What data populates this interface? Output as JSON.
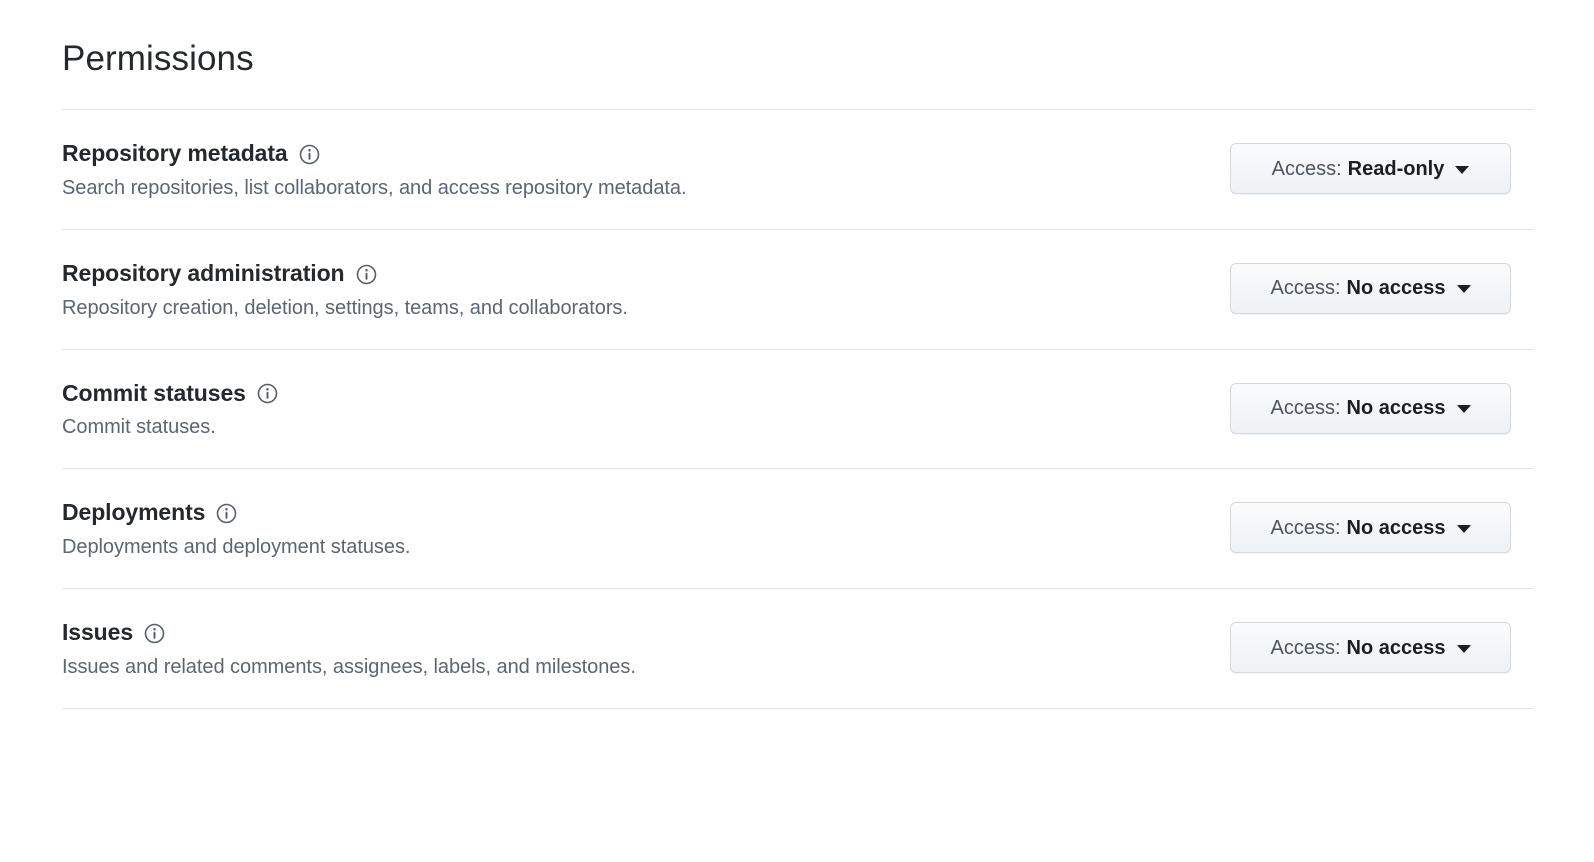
{
  "page": {
    "title": "Permissions"
  },
  "icons": {
    "info": "info-icon",
    "caret": "chevron-down-icon"
  },
  "colors": {
    "text_primary": "#24292e",
    "text_secondary": "#5a6672",
    "divider": "#e1e4e8",
    "button_border": "#d5d9dd",
    "button_bg_top": "#fafbfc",
    "button_bg_bottom": "#eff3f6",
    "button_label_prefix": "#4c555f",
    "button_label_value": "#1b1f23"
  },
  "access_label_prefix": "Access:",
  "permissions": [
    {
      "name": "Repository metadata",
      "description": "Search repositories, list collaborators, and access repository metadata.",
      "access": "Read-only"
    },
    {
      "name": "Repository administration",
      "description": "Repository creation, deletion, settings, teams, and collaborators.",
      "access": "No access"
    },
    {
      "name": "Commit statuses",
      "description": "Commit statuses.",
      "access": "No access"
    },
    {
      "name": "Deployments",
      "description": "Deployments and deployment statuses.",
      "access": "No access"
    },
    {
      "name": "Issues",
      "description": "Issues and related comments, assignees, labels, and milestones.",
      "access": "No access"
    }
  ]
}
